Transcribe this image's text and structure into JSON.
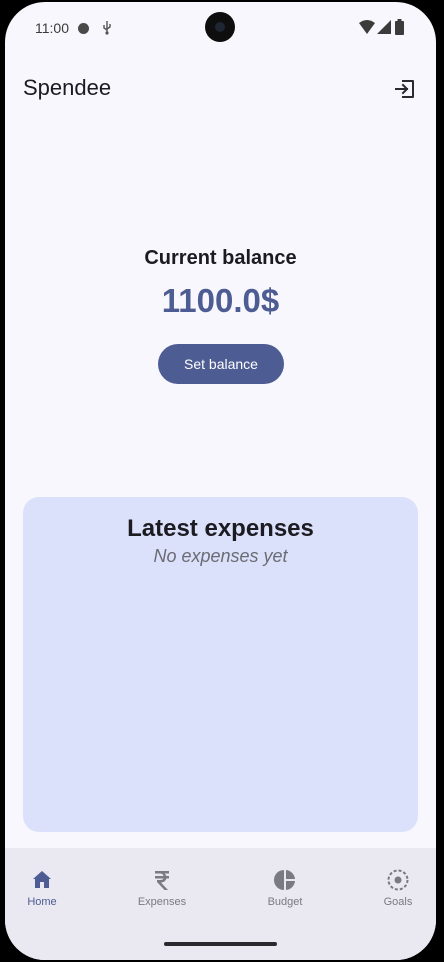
{
  "status_bar": {
    "time": "11:00"
  },
  "app_bar": {
    "title": "Spendee",
    "logout_icon": "logout-icon"
  },
  "balance": {
    "label": "Current balance",
    "amount": "1100.0$",
    "button_label": "Set balance"
  },
  "expenses": {
    "title": "Latest expenses",
    "empty_text": "No expenses yet"
  },
  "nav": {
    "items": [
      {
        "label": "Home",
        "icon": "home-icon",
        "active": true
      },
      {
        "label": "Expenses",
        "icon": "rupee-icon",
        "active": false
      },
      {
        "label": "Budget",
        "icon": "pie-chart-icon",
        "active": false
      },
      {
        "label": "Goals",
        "icon": "goals-icon",
        "active": false
      }
    ]
  },
  "colors": {
    "accent": "#4d5c92",
    "background": "#f8f7fd",
    "card": "#dce1fb",
    "nav_background": "#eae8f1"
  }
}
